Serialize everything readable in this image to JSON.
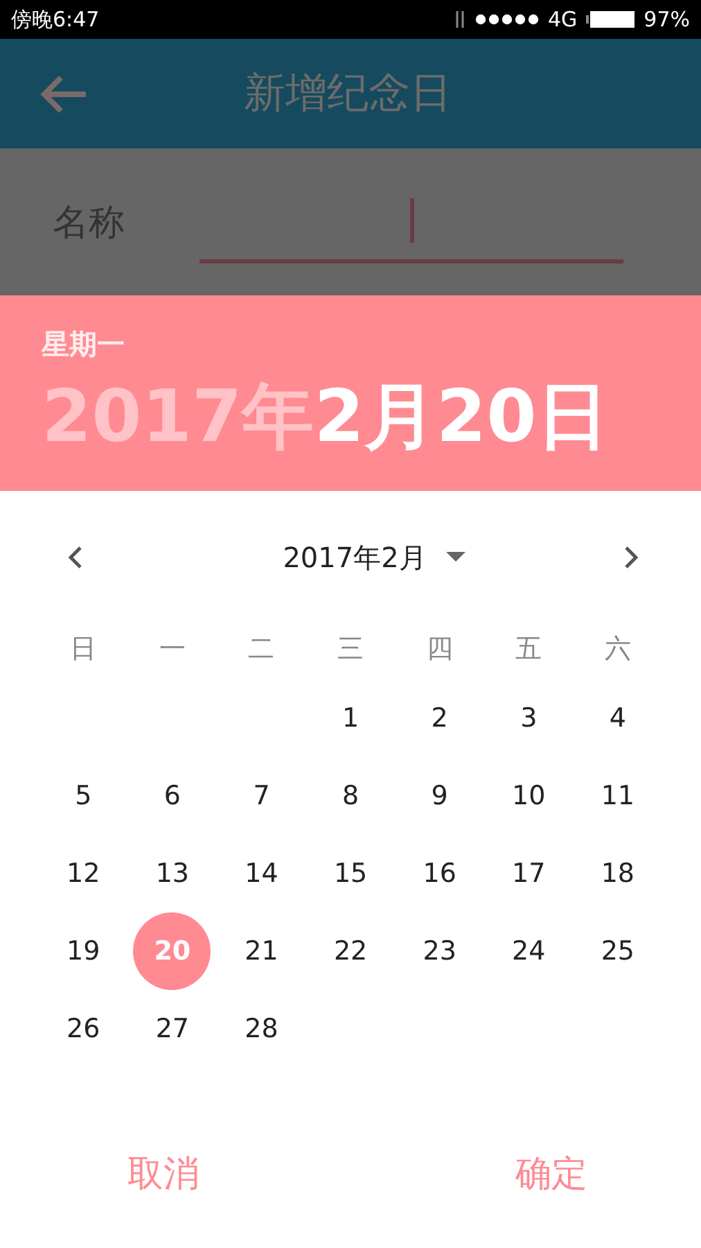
{
  "status_bar": {
    "time": "傍晚6:47",
    "network": "4G",
    "battery": "97%"
  },
  "app_bar": {
    "title": "新增纪念日"
  },
  "form": {
    "label": "名称",
    "focused": true
  },
  "date_picker": {
    "weekday": "星期一",
    "year": "2017年",
    "month_day": "2月20日",
    "month_label": "2017年2月",
    "weekdays": [
      "日",
      "一",
      "二",
      "三",
      "四",
      "五",
      "六"
    ],
    "weeks": [
      {
        "days": [
          {
            "kind": "blank"
          },
          {
            "kind": "blank"
          },
          {
            "kind": "blank"
          },
          {
            "kind": "day",
            "label": "1",
            "selected": false
          },
          {
            "label": "2",
            "selected": false
          },
          {
            "label": "3",
            "selected": false
          },
          {
            "label": "4",
            "selected": false
          }
        ]
      },
      {
        "days": [
          {
            "label": "5",
            "selected": false
          },
          {
            "label": "6",
            "selected": false
          },
          {
            "label": "7",
            "selected": false
          },
          {
            "label": "8",
            "selected": false
          },
          {
            "label": "9",
            "selected": false
          },
          {
            "label": "10",
            "selected": false
          },
          {
            "label": "11",
            "selected": false
          }
        ]
      },
      {
        "days": [
          {
            "label": "12",
            "selected": false
          },
          {
            "label": "13",
            "selected": false
          },
          {
            "label": "14",
            "selected": false
          },
          {
            "label": "15",
            "selected": false
          },
          {
            "label": "16",
            "selected": false
          },
          {
            "label": "17",
            "selected": false
          },
          {
            "label": "18",
            "selected": false
          }
        ]
      },
      {
        "days": [
          {
            "label": "19",
            "selected": false
          },
          {
            "label": "20",
            "selected": true
          },
          {
            "label": "21",
            "selected": false
          },
          {
            "label": "22",
            "selected": false
          },
          {
            "label": "23",
            "selected": false
          },
          {
            "label": "24",
            "selected": false
          },
          {
            "label": "25",
            "selected": false
          }
        ]
      },
      {
        "days": [
          {
            "label": "26",
            "selected": false
          },
          {
            "label": "27",
            "selected": false
          },
          {
            "label": "28",
            "selected": false
          }
        ]
      }
    ],
    "buttons": [
      "取消",
      "确定"
    ]
  }
}
